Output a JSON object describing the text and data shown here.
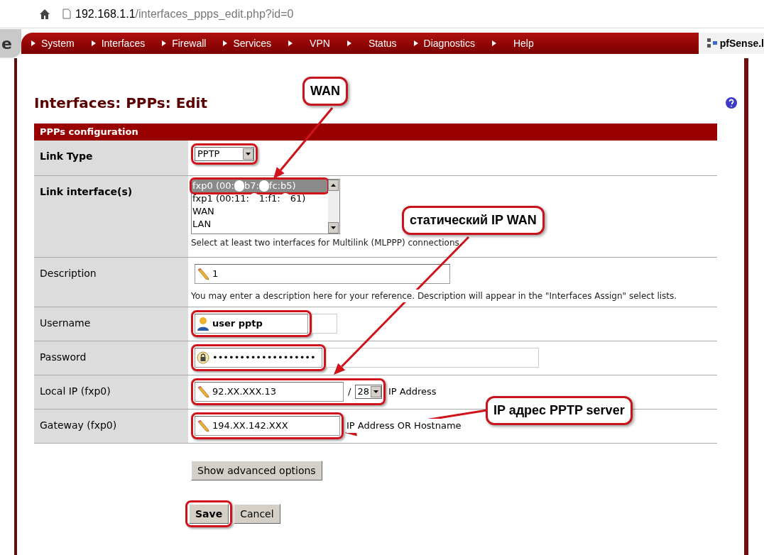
{
  "browser": {
    "url_host": "192.168.1.1",
    "url_path": "/interfaces_ppps_edit.php?id=0"
  },
  "nav": {
    "logo_fragment": "e",
    "items": [
      {
        "kind": "arrowed",
        "label": "System"
      },
      {
        "kind": "arrowed",
        "label": "Interfaces"
      },
      {
        "kind": "arrowed",
        "label": "Firewall"
      },
      {
        "kind": "arrowed",
        "label": "Services"
      },
      {
        "kind": "arrow"
      },
      {
        "kind": "plain",
        "label": "VPN"
      },
      {
        "kind": "arrow"
      },
      {
        "kind": "plain",
        "label": "Status"
      },
      {
        "kind": "arrowed",
        "label": "Diagnostics"
      },
      {
        "kind": "arrow"
      },
      {
        "kind": "plain",
        "label": "Help"
      }
    ],
    "brand": "pfSense.l"
  },
  "page": {
    "title": "Interfaces: PPPs: Edit"
  },
  "form": {
    "section": "PPPs configuration",
    "rows": [
      {
        "kind": "select",
        "label": "Link Type",
        "value": "PPTP",
        "highlighted": true
      },
      {
        "kind": "listbox",
        "label": "Link interface(s)",
        "options": [
          {
            "parts": [
              "fxp0 (00:",
              "b7:",
              "fc:b5)"
            ],
            "selected": true,
            "highlighted": true
          },
          {
            "parts": [
              "fxp1 (00:11:",
              "1:f1:",
              "61)"
            ],
            "selected": false,
            "highlighted": false
          },
          {
            "parts": [
              "WAN"
            ],
            "selected": false,
            "highlighted": false
          },
          {
            "parts": [
              "LAN"
            ],
            "selected": false,
            "highlighted": false
          }
        ],
        "hint": "Select at least two interfaces for Multilink (MLPPP) connections."
      },
      {
        "kind": "text",
        "label": "Description",
        "value": "1",
        "highlighted": false,
        "hint": "You may enter a description here for your reference. Description will appear in the \"Interfaces Assign\" select lists."
      },
      {
        "kind": "text",
        "label": "Username",
        "value": "user pptp",
        "highlighted": true
      },
      {
        "kind": "text",
        "label": "Password",
        "value": "•••••••••••••••••••",
        "highlighted": true
      },
      {
        "kind": "ip",
        "label": "Local IP (fxp0)",
        "value": "92.XX.XXX.13",
        "slash": "/",
        "mask": "28",
        "suffix": "IP Address",
        "highlighted": true
      },
      {
        "kind": "text",
        "label": "Gateway (fxp0)",
        "value": "194.XX.142.XXX",
        "suffix": "IP Address OR Hostname",
        "highlighted": true
      }
    ]
  },
  "buttons": {
    "advanced": "Show advanced options",
    "save": {
      "label": "Save",
      "highlighted": true
    },
    "cancel": "Cancel"
  },
  "callouts": [
    "WAN",
    "статический IP WAN",
    "IP адрес PPTP server"
  ]
}
